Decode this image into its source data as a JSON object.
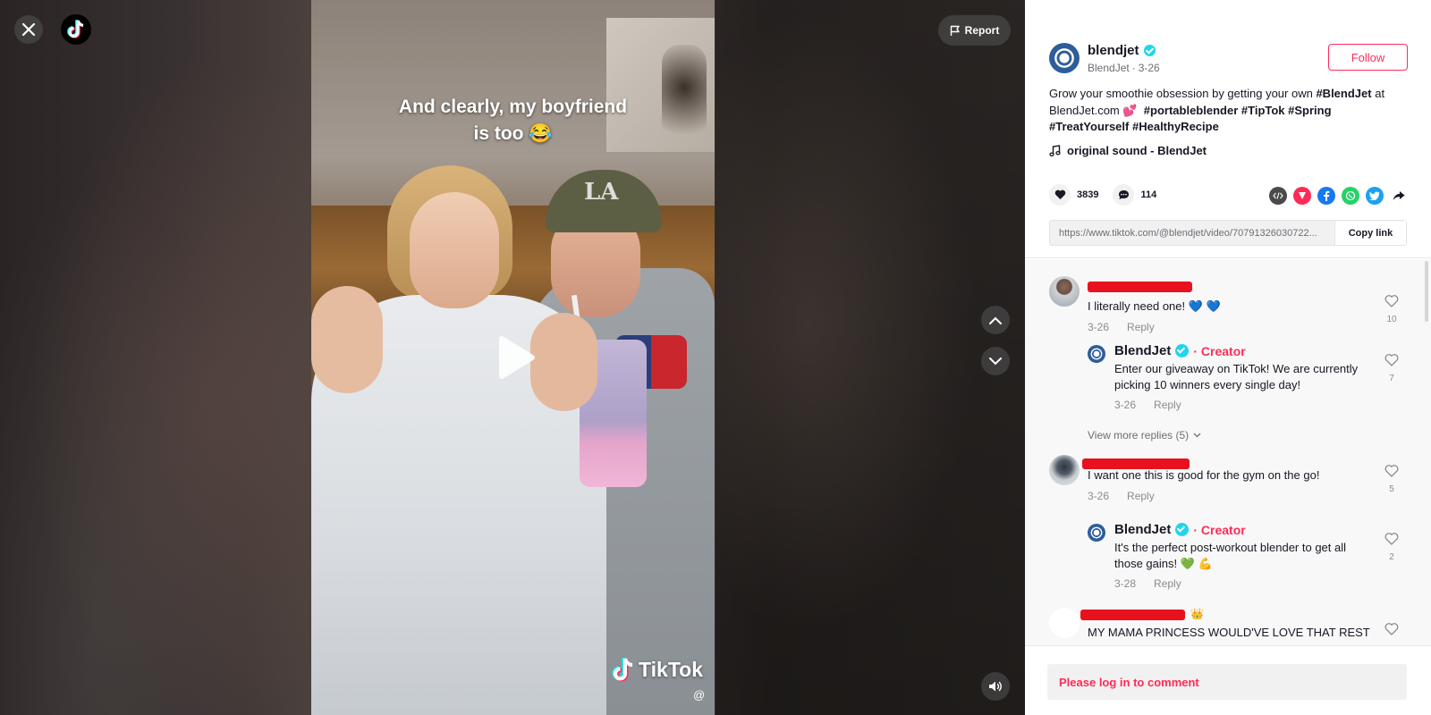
{
  "overlay": {
    "report_label": "Report"
  },
  "video": {
    "caption_line1": "And clearly, my boyfriend",
    "caption_line2": "is too 😂",
    "watermark_brand": "TikTok",
    "watermark_handle": "@"
  },
  "author": {
    "username": "blendjet",
    "display_name": "BlendJet",
    "date": "3-26",
    "follow_label": "Follow"
  },
  "description": {
    "text_prefix": "Grow your smoothie obsession by getting your own",
    "tag_blendjet": "#BlendJet",
    "text_mid": "at BlendJet.com 💕",
    "tags": [
      "#portableblender",
      "#TipTok",
      "#Spring",
      "#TreatYourself",
      "#HealthyRecipe"
    ]
  },
  "music": {
    "title": "original sound - BlendJet"
  },
  "stats": {
    "likes": "3839",
    "comments": "114"
  },
  "share": {
    "icons": [
      "embed-icon",
      "send-icon",
      "facebook-icon",
      "whatsapp-icon",
      "twitter-icon",
      "share-arrow-icon"
    ],
    "link_url": "https://www.tiktok.com/@blendjet/video/70791326030722...",
    "copy_label": "Copy link"
  },
  "comments": [
    {
      "text": "I literally need one! 💙 💙",
      "date": "3-26",
      "reply_label": "Reply",
      "likes": "10",
      "replies": [
        {
          "name": "BlendJet",
          "badge": "· Creator",
          "text_line1": "Enter our giveaway on TikTok! We are currently",
          "text_line2": "picking 10 winners every single day!",
          "date": "3-26",
          "reply_label": "Reply",
          "likes": "7"
        }
      ],
      "view_more": "View more replies (5)"
    },
    {
      "text": "I want one this is good for the gym on the go!",
      "date": "3-26",
      "reply_label": "Reply",
      "likes": "5",
      "replies": [
        {
          "name": "BlendJet",
          "badge": "· Creator",
          "text_line1": "It's the perfect post-workout blender to get all",
          "text_line2": "those gains! 💚 💪",
          "date": "3-28",
          "reply_label": "Reply",
          "likes": "2"
        }
      ]
    },
    {
      "name_suffix": "👑",
      "text": "MY MAMA PRINCESS WOULD'VE LOVE THAT REST"
    }
  ],
  "login": {
    "label": "Please log in to comment"
  },
  "colors": {
    "accent": "#fe2c55",
    "verified": "#20d5ec",
    "brand_blue": "#2d5d9b",
    "redaction": "#e8121f"
  }
}
